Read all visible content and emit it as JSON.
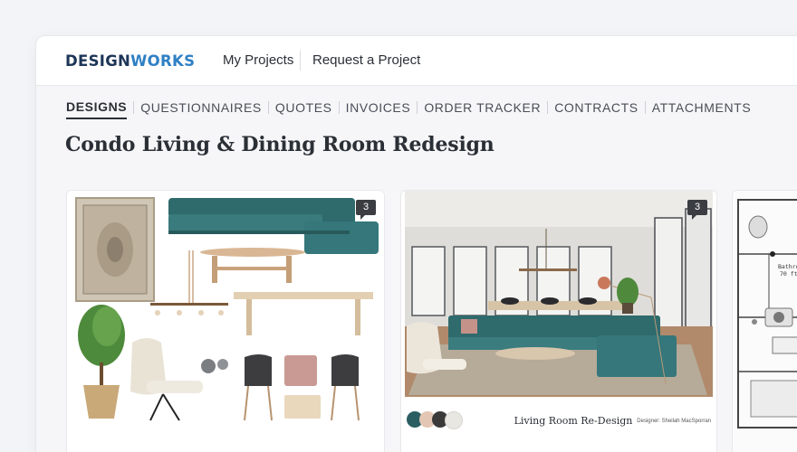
{
  "brand": {
    "part1": "DESIGN",
    "part2": "WORKS"
  },
  "topnav": [
    {
      "label": "My Projects"
    },
    {
      "label": "Request a Project"
    }
  ],
  "subnav": [
    {
      "label": "DESIGNS",
      "active": true
    },
    {
      "label": "QUESTIONNAIRES"
    },
    {
      "label": "QUOTES"
    },
    {
      "label": "INVOICES"
    },
    {
      "label": "ORDER TRACKER"
    },
    {
      "label": "CONTRACTS"
    },
    {
      "label": "ATTACHMENTS"
    }
  ],
  "page_title": "Condo Living & Dining Room Redesign",
  "cards": [
    {
      "comment_count": "3"
    },
    {
      "comment_count": "3",
      "caption": "Living Room Re-Design",
      "designer": "Designer: Sheilah MacSporran",
      "swatches": [
        "#2b5e62",
        "#e3c7b4",
        "#3a3a3a",
        "#e9e7e2"
      ]
    },
    {
      "plan_labels": [
        "Bathroom",
        "70 ft"
      ]
    }
  ]
}
